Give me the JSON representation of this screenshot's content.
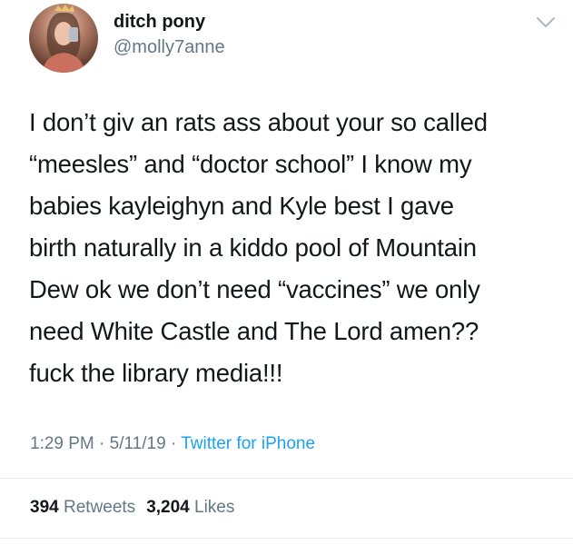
{
  "user": {
    "display_name": "ditch pony",
    "handle": "@molly7anne"
  },
  "tweet": {
    "text": "I don’t giv an rats ass about your so called\n“meesles” and “doctor school” I know my\nbabies kayleighyn and Kyle best I gave\nbirth naturally in a kiddo pool of Mountain\nDew ok we don’t need “vaccines” we only\nneed White Castle and The Lord amen??\nfuck the library media!!!",
    "time": "1:29 PM",
    "date": "5/11/19",
    "separator": "·",
    "source": "Twitter for iPhone"
  },
  "stats": {
    "retweets_count": "394",
    "retweets_label": "Retweets",
    "likes_count": "3,204",
    "likes_label": "Likes"
  },
  "icons": {
    "menu": "chevron-down-icon",
    "avatar": "profile-photo"
  },
  "colors": {
    "text": "#14171a",
    "secondary": "#657786",
    "link": "#1da1f2",
    "divider": "#e6ecf0"
  }
}
